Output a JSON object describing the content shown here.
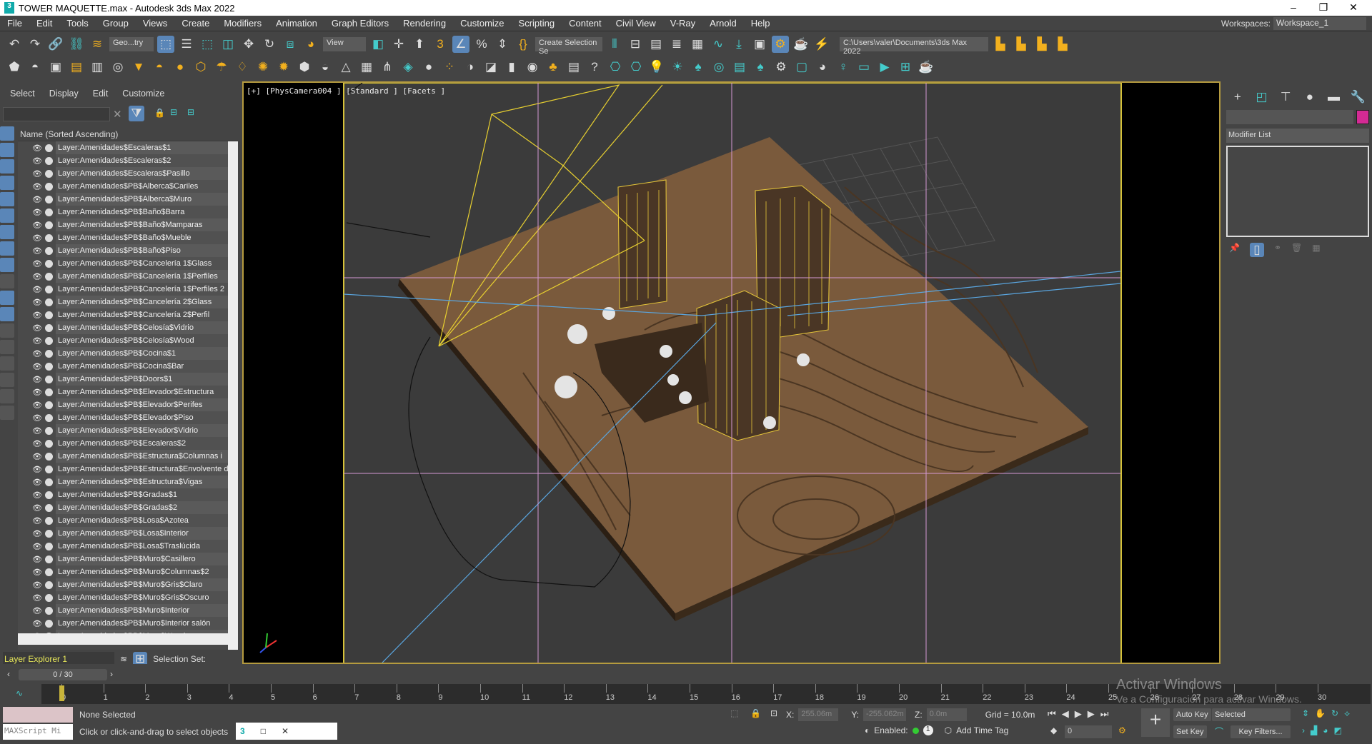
{
  "window": {
    "title": "TOWER MAQUETTE.max - Autodesk 3ds Max 2022",
    "minimize": "–",
    "restore": "❐",
    "close": "✕",
    "logo": "3"
  },
  "menu": [
    "File",
    "Edit",
    "Tools",
    "Group",
    "Views",
    "Create",
    "Modifiers",
    "Animation",
    "Graph Editors",
    "Rendering",
    "Customize",
    "Scripting",
    "Content",
    "Civil View",
    "V-Ray",
    "Arnold",
    "Help"
  ],
  "workspaces": {
    "label": "Workspaces:",
    "value": "Workspace_1"
  },
  "toolbar1": {
    "selection_filter": "Geo...try",
    "ref_coord": "View",
    "named_selection": "Create Selection Se",
    "project_path": "C:\\Users\\valer\\Documents\\3ds Max 2022"
  },
  "scene_explorer": {
    "menu": [
      "Select",
      "Display",
      "Edit",
      "Customize"
    ],
    "column_header": "Name (Sorted Ascending)",
    "items": [
      "Layer:Amenidades$Escaleras$1",
      "Layer:Amenidades$Escaleras$2",
      "Layer:Amenidades$Escaleras$Pasillo",
      "Layer:Amenidades$PB$Alberca$Cariles",
      "Layer:Amenidades$PB$Alberca$Muro",
      "Layer:Amenidades$PB$Baño$Barra",
      "Layer:Amenidades$PB$Baño$Mamparas",
      "Layer:Amenidades$PB$Baño$Mueble",
      "Layer:Amenidades$PB$Baño$Piso",
      "Layer:Amenidades$PB$Cancelería 1$Glass",
      "Layer:Amenidades$PB$Cancelería 1$Perfiles",
      "Layer:Amenidades$PB$Cancelería 1$Perfiles 2",
      "Layer:Amenidades$PB$Cancelería 2$Glass",
      "Layer:Amenidades$PB$Cancelería 2$Perfil",
      "Layer:Amenidades$PB$Celosía$Vidrio",
      "Layer:Amenidades$PB$Celosía$Wood",
      "Layer:Amenidades$PB$Cocina$1",
      "Layer:Amenidades$PB$Cocina$Bar",
      "Layer:Amenidades$PB$Doors$1",
      "Layer:Amenidades$PB$Elevador$Estructura",
      "Layer:Amenidades$PB$Elevador$Perifes",
      "Layer:Amenidades$PB$Elevador$Piso",
      "Layer:Amenidades$PB$Elevador$Vidrio",
      "Layer:Amenidades$PB$Escaleras$2",
      "Layer:Amenidades$PB$Estructura$Columnas i",
      "Layer:Amenidades$PB$Estructura$Envolvente de",
      "Layer:Amenidades$PB$Estructura$Vigas",
      "Layer:Amenidades$PB$Gradas$1",
      "Layer:Amenidades$PB$Gradas$2",
      "Layer:Amenidades$PB$Losa$Azotea",
      "Layer:Amenidades$PB$Losa$Interior",
      "Layer:Amenidades$PB$Losa$Traslúcida",
      "Layer:Amenidades$PB$Muro$Casillero",
      "Layer:Amenidades$PB$Muro$Columnas$2",
      "Layer:Amenidades$PB$Muro$Gris$Claro",
      "Layer:Amenidades$PB$Muro$Gris$Oscuro",
      "Layer:Amenidades$PB$Muro$Interior",
      "Layer:Amenidades$PB$Muro$Interior salón",
      "Layer:Amenidades$PB$Muro$Wood"
    ],
    "explorer_name": "Layer Explorer 1",
    "selection_set_label": "Selection Set:"
  },
  "viewport": {
    "label": "[+] [PhysCamera004 ] [Standard ] [Facets ]"
  },
  "command_panel": {
    "modifier_list": "Modifier List",
    "object_color": "#d42a94"
  },
  "timeline": {
    "position": "0 / 30",
    "current_frame": 0,
    "ticks": [
      0,
      1,
      2,
      3,
      4,
      5,
      6,
      7,
      8,
      9,
      10,
      11,
      12,
      13,
      14,
      15,
      16,
      17,
      18,
      19,
      20,
      21,
      22,
      23,
      24,
      25,
      26,
      27,
      28,
      29,
      30
    ]
  },
  "status": {
    "selection": "None Selected",
    "prompt": "Click or click-and-drag to select objects",
    "maxscript": "MAXScript Mi",
    "x_label": "X:",
    "x": "255.06m",
    "y_label": "Y:",
    "y": "-255.062m",
    "z_label": "Z:",
    "z": "0.0m",
    "grid": "Grid = 10.0m",
    "enabled_label": "Enabled:",
    "add_time_tag": "Add Time Tag",
    "frame": "0",
    "auto_key": "Auto Key",
    "set_key": "Set Key",
    "key_mode": "Selected",
    "key_filters": "Key Filters..."
  },
  "watermark": {
    "line1": "Activar Windows",
    "line2": "Ve a Configuración para activar Windows."
  }
}
